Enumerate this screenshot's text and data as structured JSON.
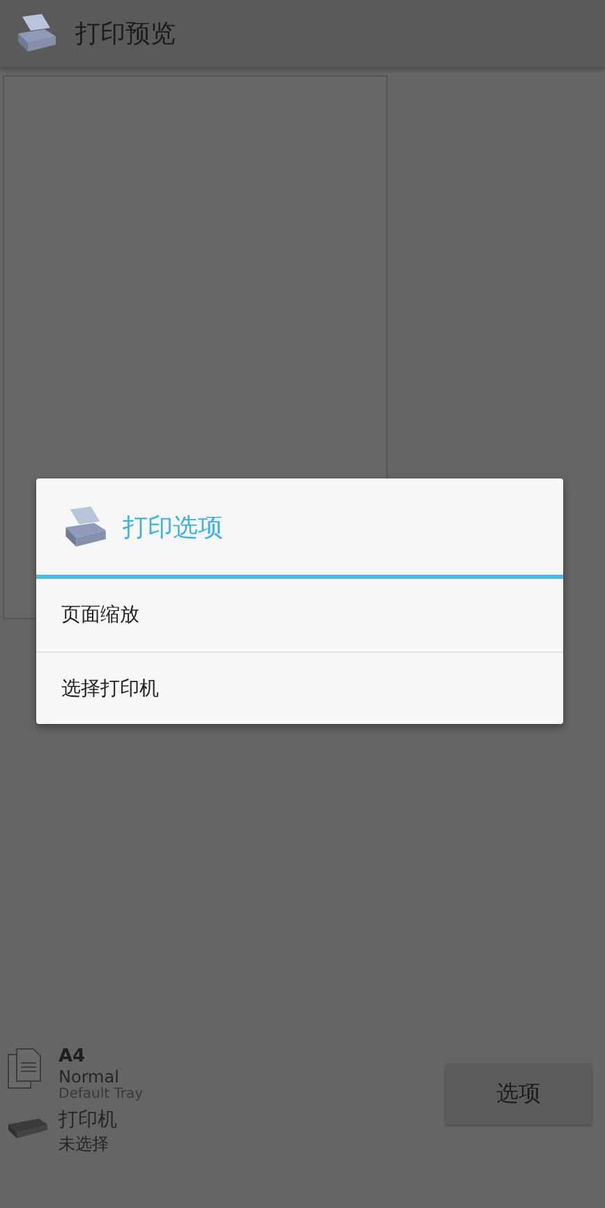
{
  "app_bar": {
    "title": "打印预览"
  },
  "dialog": {
    "title": "打印选项",
    "items": [
      {
        "label": "页面缩放"
      },
      {
        "label": "选择打印机"
      }
    ]
  },
  "paper": {
    "size": "A4",
    "quality": "Normal",
    "tray": "Default Tray"
  },
  "printer": {
    "label": "打印机",
    "value": "未选择"
  },
  "buttons": [
    "选项"
  ]
}
